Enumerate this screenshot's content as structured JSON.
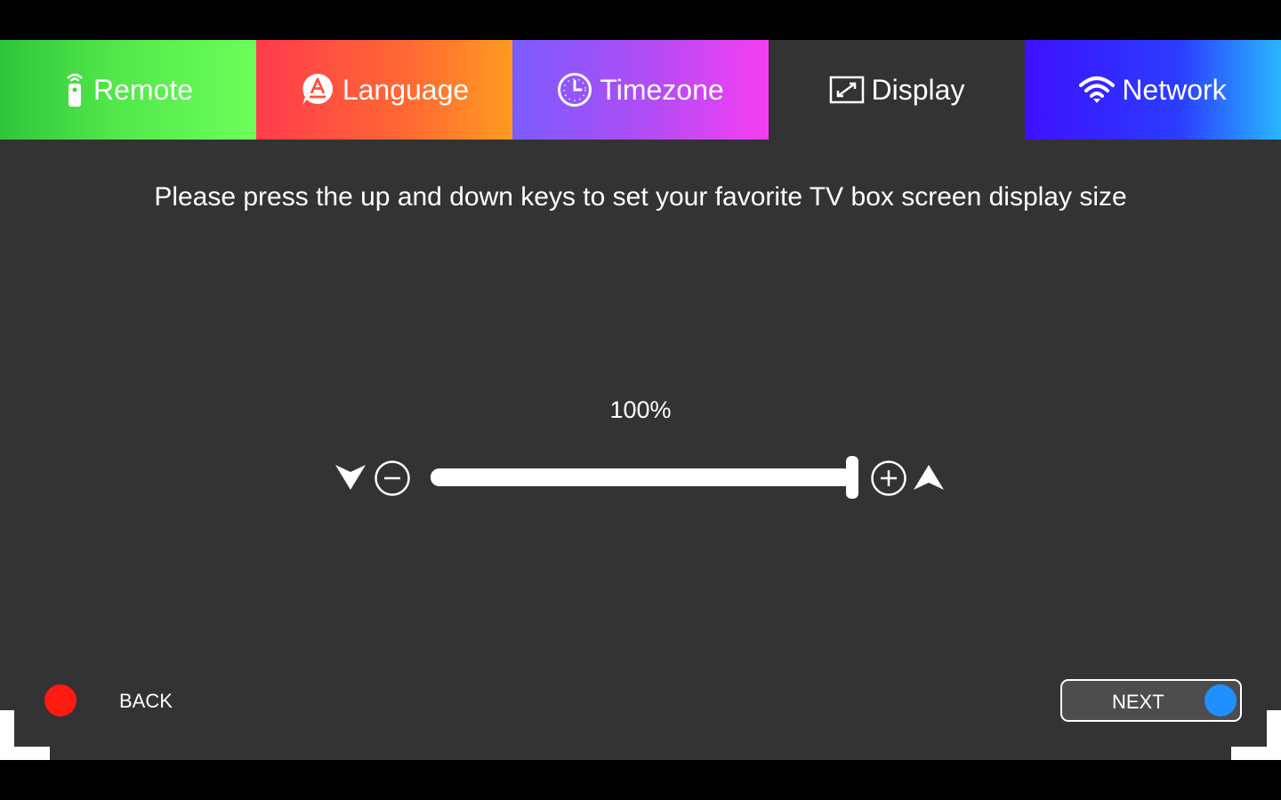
{
  "tabs": [
    {
      "id": "remote",
      "label": "Remote",
      "icon": "remote-control-icon",
      "active": false
    },
    {
      "id": "language",
      "label": "Language",
      "icon": "language-icon",
      "active": false
    },
    {
      "id": "timezone",
      "label": "Timezone",
      "icon": "clock-icon",
      "active": false
    },
    {
      "id": "display",
      "label": "Display",
      "icon": "display-resize-icon",
      "active": true
    },
    {
      "id": "network",
      "label": "Network",
      "icon": "wifi-icon",
      "active": false
    }
  ],
  "display": {
    "instruction": "Please press the up and down keys to set your favorite TV box screen display size",
    "percent_label": "100%",
    "size_percent": 100,
    "decrease_icon": "minus-circle-icon",
    "increase_icon": "plus-circle-icon",
    "down_key_icon": "down-arrow-icon",
    "up_key_icon": "up-arrow-icon"
  },
  "footer": {
    "back_label": "BACK",
    "next_label": "NEXT"
  },
  "colors": {
    "background": "#333333",
    "back_dot": "#ff1a12",
    "next_dot": "#1e90ff",
    "remote_tab": "#52e84a",
    "language_tab": "#ff6a32",
    "timezone_tab": "#b44cf5",
    "network_tab": "#2b3cff"
  }
}
